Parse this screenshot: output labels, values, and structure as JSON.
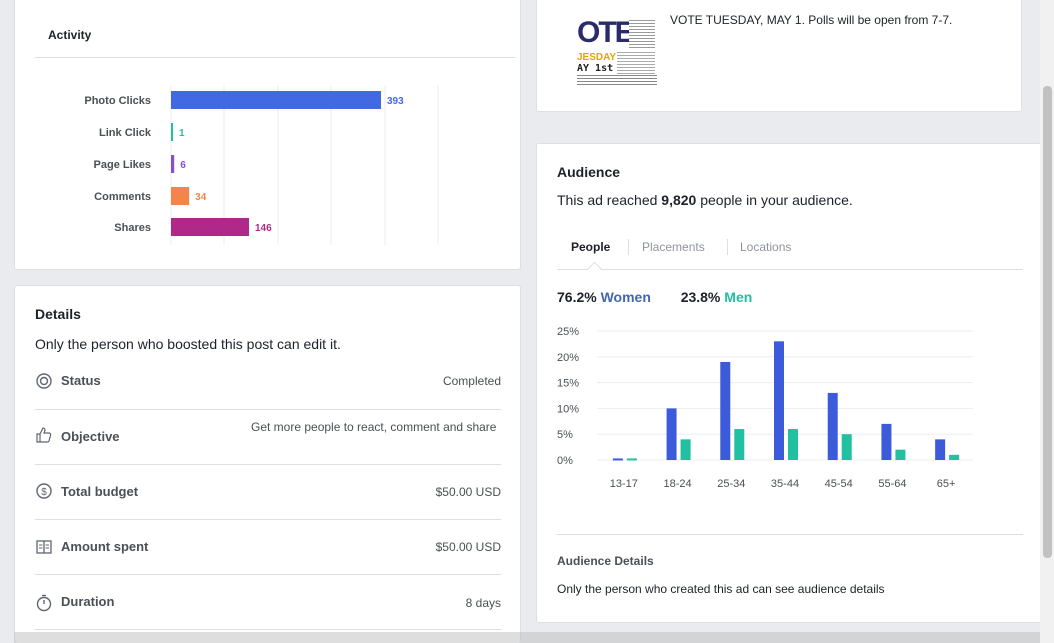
{
  "activity": {
    "tab_label": "Activity",
    "chart_data": {
      "type": "bar",
      "orientation": "horizontal",
      "categories": [
        "Photo Clicks",
        "Link Click",
        "Page Likes",
        "Comments",
        "Shares"
      ],
      "values": [
        393,
        1,
        6,
        34,
        146
      ],
      "value_labels": [
        "393",
        "1",
        "6",
        "34",
        "146"
      ],
      "colors": [
        "#4169e1",
        "#20c0a0",
        "#8a4fcf",
        "#f5844c",
        "#b0298a"
      ],
      "grid": true
    }
  },
  "details": {
    "title": "Details",
    "subtitle": "Only the person who boosted this post can edit it.",
    "rows": [
      {
        "icon": "status-icon",
        "label": "Status",
        "value": "Completed"
      },
      {
        "icon": "thumbs-up-icon",
        "label": "Objective",
        "value": "Get more people to react, comment and share"
      },
      {
        "icon": "dollar-icon",
        "label": "Total budget",
        "value": "$50.00 USD"
      },
      {
        "icon": "ledger-icon",
        "label": "Amount spent",
        "value": "$50.00 USD"
      },
      {
        "icon": "stopwatch-icon",
        "label": "Duration",
        "value": "8 days"
      }
    ]
  },
  "post": {
    "text": "VOTE TUESDAY, MAY 1. Polls will be open from 7-7.",
    "thumb_line1": "OTE",
    "thumb_line2": "JESDAY",
    "thumb_line3": "AY 1st"
  },
  "audience": {
    "title": "Audience",
    "reach_prefix": "This ad reached ",
    "reach_count": "9,820",
    "reach_suffix": " people in your audience.",
    "tabs": [
      "People",
      "Placements",
      "Locations"
    ],
    "women_pct": "76.2%",
    "women_label": "Women",
    "men_pct": "23.8%",
    "men_label": "Men",
    "chart_data": {
      "type": "bar",
      "categories": [
        "13-17",
        "18-24",
        "25-34",
        "35-44",
        "45-54",
        "55-64",
        "65+"
      ],
      "series": [
        {
          "name": "Women",
          "values": [
            0.3,
            10,
            19,
            23,
            13,
            7,
            4
          ],
          "color": "#3b5bdb"
        },
        {
          "name": "Men",
          "values": [
            0.3,
            4,
            6,
            6,
            5,
            2,
            1
          ],
          "color": "#20c0a0"
        }
      ],
      "yticks": [
        "25%",
        "20%",
        "15%",
        "10%",
        "5%",
        "0%"
      ],
      "ylim": [
        0,
        25
      ],
      "grid": true
    },
    "details_title": "Audience Details",
    "details_text": "Only the person who created this ad can see audience details"
  }
}
